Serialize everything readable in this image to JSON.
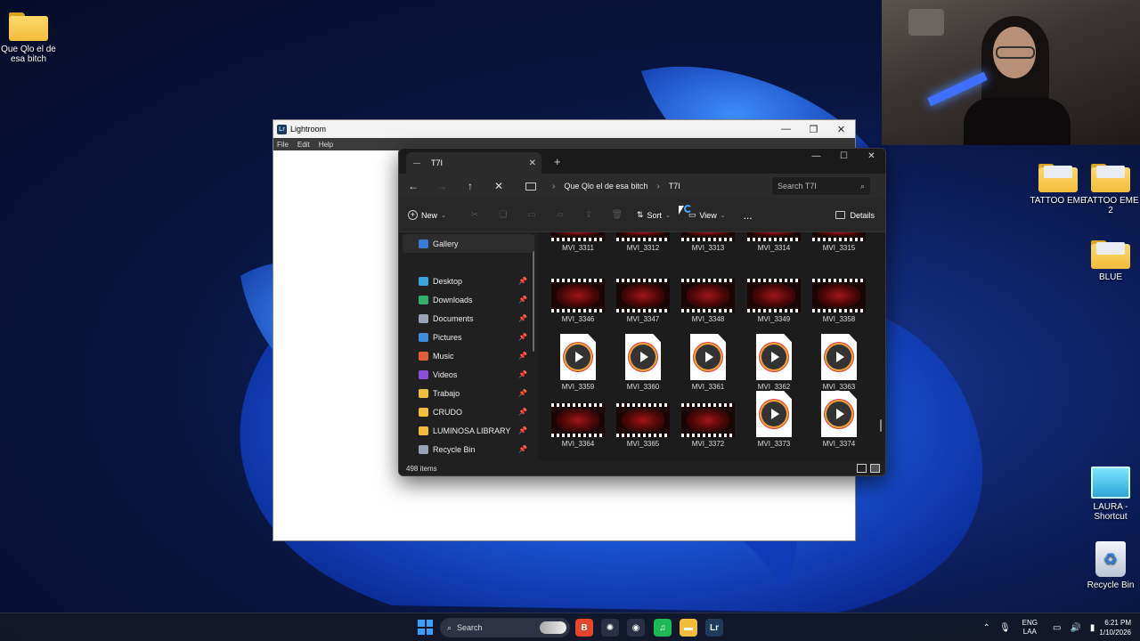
{
  "desktop": {
    "icons": [
      {
        "label": "Que Qlo el de esa bitch"
      },
      {
        "label": "TATTOO EME"
      },
      {
        "label": "TATTOO EME 2"
      },
      {
        "label": "BLUE"
      },
      {
        "label": "LAURA - Shortcut"
      },
      {
        "label": "Recycle Bin"
      }
    ]
  },
  "lightroom": {
    "title": "Lightroom",
    "logo": "Lr",
    "menu": [
      "File",
      "Edit",
      "Help"
    ]
  },
  "explorer": {
    "tab_title": "T7I",
    "breadcrumb": [
      "Que Qlo el de esa bitch",
      "T7I"
    ],
    "search_placeholder": "Search T7I",
    "toolbar": {
      "new": "New",
      "sort": "Sort",
      "view": "View",
      "details": "Details",
      "more": "..."
    },
    "sidebar": [
      {
        "label": "Gallery",
        "color": "#3a7bd5",
        "pinned": false
      },
      {
        "label": "Desktop",
        "color": "#39a3e0",
        "pinned": true
      },
      {
        "label": "Downloads",
        "color": "#2fb36a",
        "pinned": true
      },
      {
        "label": "Documents",
        "color": "#9aa3b5",
        "pinned": true
      },
      {
        "label": "Pictures",
        "color": "#3c8fe0",
        "pinned": true
      },
      {
        "label": "Music",
        "color": "#e0603c",
        "pinned": true
      },
      {
        "label": "Videos",
        "color": "#8a4de0",
        "pinned": true
      },
      {
        "label": "Trabajo",
        "color": "#f3bd3c",
        "pinned": true
      },
      {
        "label": "CRUDO",
        "color": "#f3bd3c",
        "pinned": true
      },
      {
        "label": "LUMINOSA LIBRARY",
        "color": "#f3bd3c",
        "pinned": true
      },
      {
        "label": "Recycle Bin",
        "color": "#9aa3b5",
        "pinned": true
      }
    ],
    "files": [
      {
        "name": "MVI_3311",
        "kind": "video-thumb"
      },
      {
        "name": "MVI_3312",
        "kind": "video-thumb"
      },
      {
        "name": "MVI_3313",
        "kind": "video-thumb"
      },
      {
        "name": "MVI_3314",
        "kind": "video-thumb"
      },
      {
        "name": "MVI_3315",
        "kind": "video-thumb"
      },
      {
        "name": "MVI_3346",
        "kind": "video-thumb"
      },
      {
        "name": "MVI_3347",
        "kind": "video-thumb"
      },
      {
        "name": "MVI_3348",
        "kind": "video-thumb"
      },
      {
        "name": "MVI_3349",
        "kind": "video-thumb"
      },
      {
        "name": "MVI_3358",
        "kind": "video-thumb"
      },
      {
        "name": "MVI_3359",
        "kind": "video-file"
      },
      {
        "name": "MVI_3360",
        "kind": "video-file"
      },
      {
        "name": "MVI_3361",
        "kind": "video-file"
      },
      {
        "name": "MVI_3362",
        "kind": "video-file"
      },
      {
        "name": "MVI_3363",
        "kind": "video-file"
      },
      {
        "name": "MVI_3364",
        "kind": "video-thumb"
      },
      {
        "name": "MVI_3365",
        "kind": "video-thumb"
      },
      {
        "name": "MVI_3372",
        "kind": "video-thumb"
      },
      {
        "name": "MVI_3373",
        "kind": "video-file"
      },
      {
        "name": "MVI_3374",
        "kind": "video-file"
      }
    ],
    "status": "498 items"
  },
  "taskbar": {
    "search_label": "Search",
    "lang_top": "ENG",
    "lang_bottom": "LAA",
    "time": "6:21 PM",
    "date": "1/10/2026",
    "apps": [
      {
        "icon": "brave-icon",
        "color": "#e5452b",
        "glyph": "B"
      },
      {
        "icon": "chatgpt-icon",
        "color": "#2a2f45",
        "glyph": "✺"
      },
      {
        "icon": "chrome-icon",
        "color": "#2a2f45",
        "glyph": "◉"
      },
      {
        "icon": "spotify-icon",
        "color": "#1db954",
        "glyph": "♫"
      },
      {
        "icon": "file-explorer-icon",
        "color": "#f3bd3c",
        "glyph": "▬"
      },
      {
        "icon": "lightroom-icon",
        "color": "#1e3b5a",
        "glyph": "Lr"
      }
    ]
  }
}
